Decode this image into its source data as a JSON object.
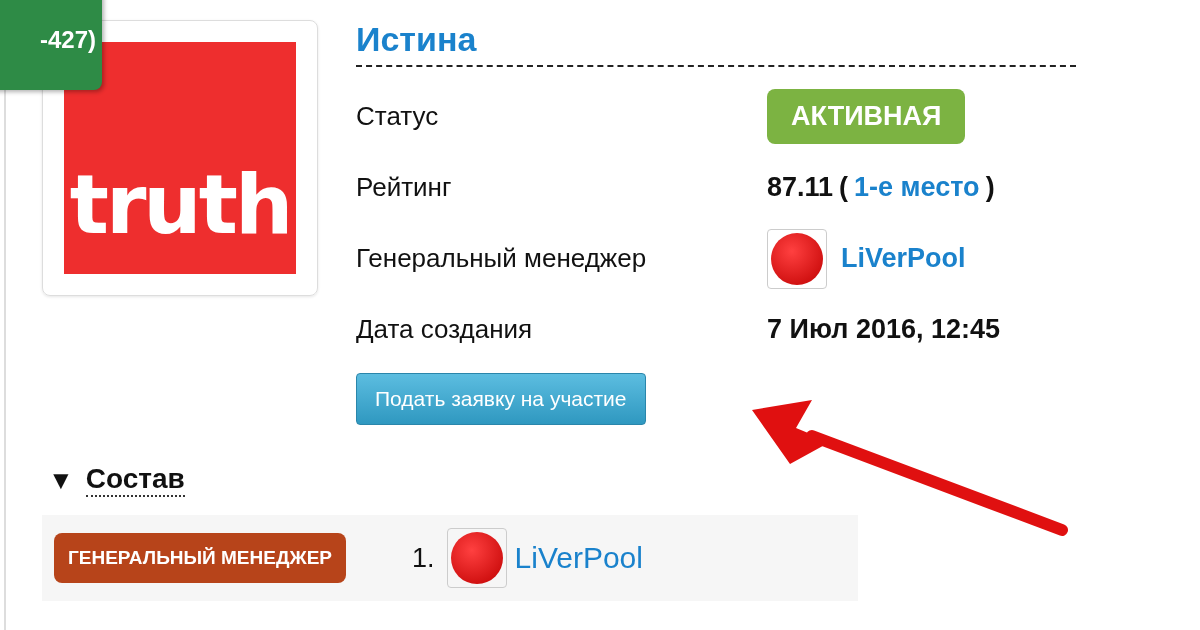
{
  "rank_badge": "-427)",
  "logo": {
    "text": "truth"
  },
  "title": "Истина",
  "details": [
    {
      "kind": "status",
      "label": "Статус",
      "value": "АКТИВНАЯ"
    },
    {
      "kind": "rating",
      "label": "Рейтинг",
      "value": "87.11",
      "open": "(",
      "link": "1-е место",
      "close": ")"
    },
    {
      "kind": "user",
      "label": "Генеральный менеджер",
      "value": "LiVerPool"
    },
    {
      "kind": "text",
      "label": "Дата создания",
      "value": "7 Июл 2016, 12:45"
    }
  ],
  "apply_button": "Подать заявку на участие",
  "roster": {
    "toggle": "▼",
    "title": "Состав",
    "expanded": true,
    "members": [
      {
        "role": "ГЕНЕРАЛЬНЫЙ МЕНЕДЖЕР",
        "number": "1.",
        "name": "LiVerPool"
      }
    ]
  }
}
